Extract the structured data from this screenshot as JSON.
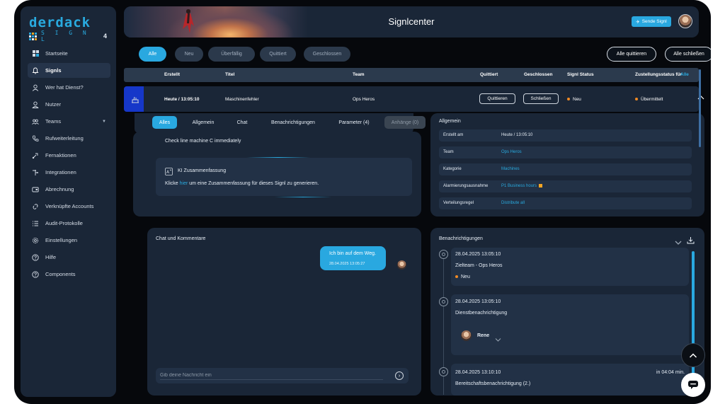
{
  "logo": {
    "top": "derdack",
    "bottom": "S I G N L",
    "version": "4"
  },
  "sidebar": {
    "items": [
      {
        "label": "Startseite",
        "icon": "dashboard-icon"
      },
      {
        "label": "Signls",
        "icon": "bell-icon",
        "active": true
      },
      {
        "label": "Wer hat Dienst?",
        "icon": "person-icon"
      },
      {
        "label": "Nutzer",
        "icon": "user-icon"
      },
      {
        "label": "Teams",
        "icon": "team-icon",
        "has_caret": true
      },
      {
        "label": "Rufweiterleitung",
        "icon": "phone-icon"
      },
      {
        "label": "Fernaktionen",
        "icon": "remote-icon"
      },
      {
        "label": "Integrationen",
        "icon": "integration-icon"
      },
      {
        "label": "Abrechnung",
        "icon": "billing-icon"
      },
      {
        "label": "Verknüpfte Accounts",
        "icon": "link-icon"
      },
      {
        "label": "Audit-Protokolle",
        "icon": "list-icon"
      },
      {
        "label": "Einstellungen",
        "icon": "gear-icon"
      },
      {
        "label": "Hilfe",
        "icon": "help-icon"
      },
      {
        "label": "Components",
        "icon": "components-icon"
      }
    ]
  },
  "header": {
    "title": "Signlcenter",
    "send_label": "Sende Signl"
  },
  "filters": {
    "pills": [
      "Alle",
      "Neu",
      "Überfällig",
      "Quittiert",
      "Geschlossen"
    ],
    "active": "Alle",
    "ack_all": "Alle quittieren",
    "close_all": "Alle schließen"
  },
  "table": {
    "headers": {
      "created": "Erstellt",
      "title": "Titel",
      "team": "Team",
      "acked": "Quittiert",
      "closed": "Geschlossen",
      "status": "Signl Status",
      "delivery": "Zustellungsstatus für",
      "delivery_filter": "Alle"
    },
    "row": {
      "created": "Heute / 13:05:10",
      "title": "Maschinenfehler",
      "team": "Ops Heros",
      "ack_button": "Quittieren",
      "close_button": "Schließen",
      "status": "Neu",
      "delivery": "Übermittelt"
    }
  },
  "detail_tabs": [
    "Alles",
    "Allgemein",
    "Chat",
    "Benachrichtigungen",
    "Parameter (4)",
    "Anhänge (0)"
  ],
  "description": {
    "text": "Check line machine C immediately",
    "ai_title": "KI Zusammenfassung",
    "ai_prefix": "Klicke ",
    "ai_link": "hier",
    "ai_suffix": " um eine Zusammenfassung für dieses Signl zu generieren."
  },
  "general": {
    "title": "Allgemein",
    "rows": [
      {
        "key": "Erstellt am",
        "value": "Heute / 13:05:10",
        "link": false
      },
      {
        "key": "Team",
        "value": "Ops Heros",
        "link": true
      },
      {
        "key": "Kategorie",
        "value": "Machines",
        "link": true
      },
      {
        "key": "Alarmierungsausnahme",
        "value": "P1 Business hours",
        "link": true
      },
      {
        "key": "Verteilungsregel",
        "value": "Distribute all",
        "link": true
      }
    ]
  },
  "chat": {
    "title": "Chat und Kommentare",
    "message": "Ich bin auf dem Weg.",
    "time": "28.04.2025 13:05:27",
    "placeholder": "Gib deine Nachricht ein"
  },
  "notifications": {
    "title": "Benachrichtigungen",
    "items": [
      {
        "time": "28.04.2025 13:05:10",
        "line1": "Zielteam - Ops Heros",
        "status": "Neu"
      },
      {
        "time": "28.04.2025 13:05:10",
        "line1": "Dienstbenachrichtigung",
        "user": "Rene"
      },
      {
        "time": "28.04.2025 13:10:10",
        "line1": "Bereitschaftsbenachrichtigung (2.)",
        "suffix": "in 04:04 min."
      }
    ]
  },
  "colors": {
    "accent": "#29a8e0",
    "panel": "#1a2637",
    "status_orange": "#f08a24",
    "row_marker": "#1637c9"
  }
}
